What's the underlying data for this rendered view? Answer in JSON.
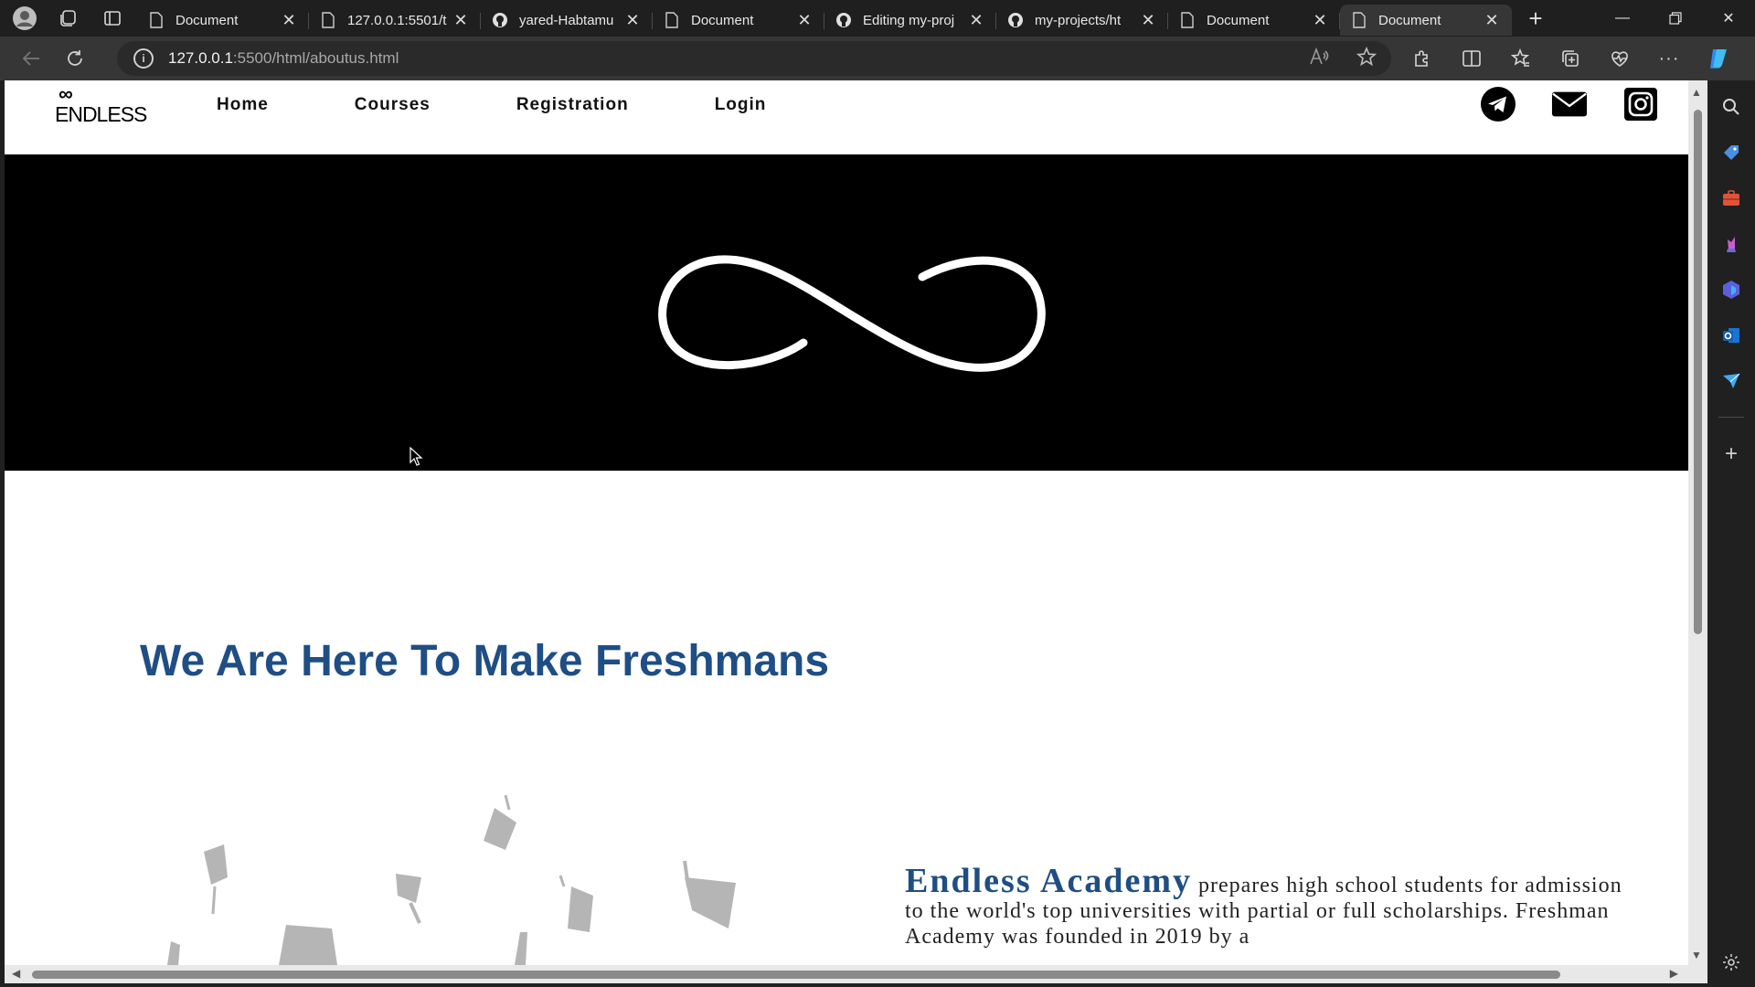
{
  "browser": {
    "tabs": [
      {
        "title": "Document",
        "favicon": "page-icon",
        "active": false
      },
      {
        "title": "127.0.0.1:5501/t",
        "favicon": "page-icon",
        "active": false
      },
      {
        "title": "yared-Habtamu",
        "favicon": "github-icon",
        "active": false
      },
      {
        "title": "Document",
        "favicon": "page-icon",
        "active": false
      },
      {
        "title": "Editing my-proj",
        "favicon": "github-icon",
        "active": false
      },
      {
        "title": "my-projects/ht",
        "favicon": "github-icon",
        "active": false
      },
      {
        "title": "Document",
        "favicon": "page-icon",
        "active": false
      },
      {
        "title": "Document",
        "favicon": "page-icon",
        "active": true
      }
    ],
    "address": {
      "host": "127.0.0.1",
      "path": ":5500/html/aboutus.html"
    }
  },
  "site": {
    "logo_text": "ENDLESS",
    "logo_mark": "∞",
    "nav": [
      "Home",
      "Courses",
      "Registration",
      "Login"
    ],
    "social": [
      "telegram-icon",
      "mail-icon",
      "instagram-icon"
    ]
  },
  "content": {
    "headline": "We Are Here To Make Freshmans",
    "about_brand": "Endless Academy",
    "about_text": " prepares high school students for admission to the world's top universities with partial or full scholarships. Freshman Academy was founded in 2019 by a"
  },
  "colors": {
    "accent": "#1f4e85",
    "hero_bg": "#000000"
  }
}
